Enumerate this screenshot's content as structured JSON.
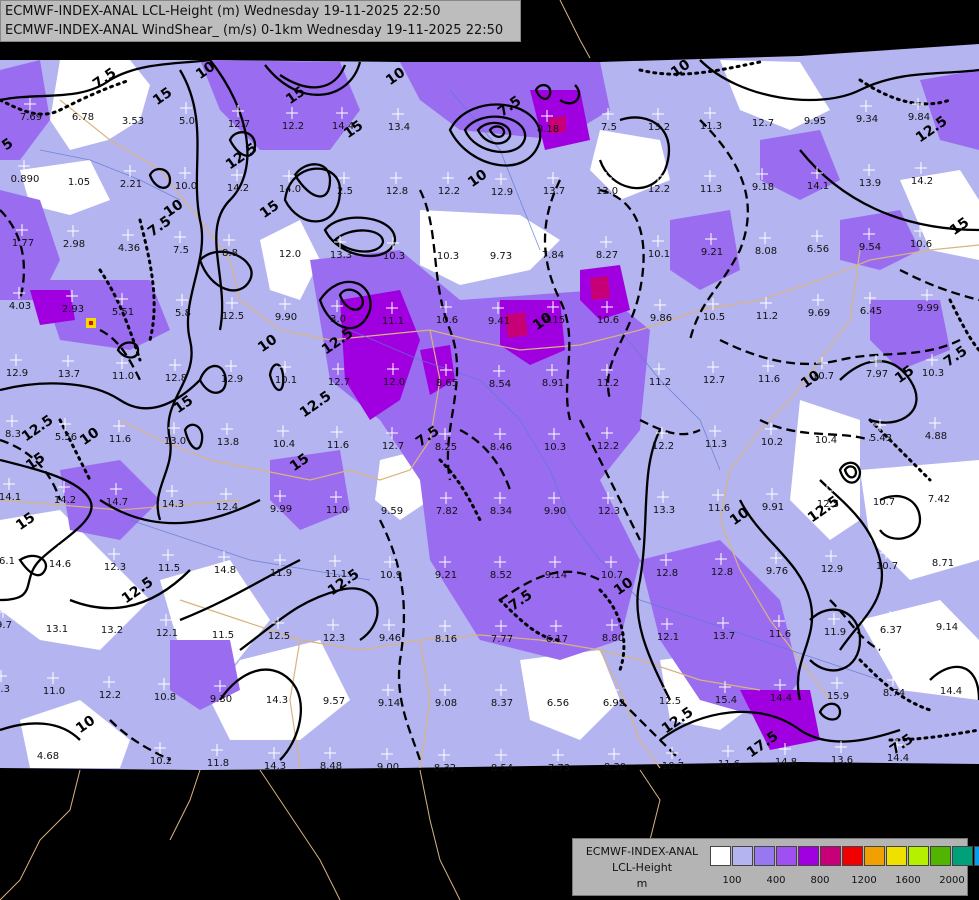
{
  "header": {
    "line1": "ECMWF-INDEX-ANAL LCL-Height (m) Wednesday 19-11-2025 22:50",
    "line2": "ECMWF-INDEX-ANAL WindShear_ (m/s) 0-1km Wednesday 19-11-2025 22:50"
  },
  "legend": {
    "title1": "ECMWF-INDEX-ANAL",
    "title2": "LCL-Height",
    "title3": "m",
    "colors": [
      "#ffffff",
      "#b4b4f0",
      "#9878f0",
      "#a050f0",
      "#a000e0",
      "#c80078",
      "#f00000",
      "#f0a000",
      "#f0e000",
      "#b4f000",
      "#50b400",
      "#00a078",
      "#00a0f0"
    ],
    "ticks": [
      "100",
      "400",
      "800",
      "1200",
      "1600",
      "2000"
    ]
  },
  "map": {
    "palette": {
      "white": "#ffffff",
      "lavender": "#b4b4f0",
      "light_purple": "#9a6cf0",
      "purple": "#a000e0",
      "magenta": "#c80078",
      "mask": "#000000"
    },
    "values": [
      [
        "7.69",
        30,
        116
      ],
      [
        "6.78",
        82,
        116
      ],
      [
        "3.53",
        132,
        120
      ],
      [
        "5.0",
        186,
        120
      ],
      [
        "12.7",
        238,
        123
      ],
      [
        "12.2",
        292,
        125
      ],
      [
        "14.4",
        342,
        125
      ],
      [
        "13.4",
        398,
        126
      ],
      [
        "8.18",
        547,
        128
      ],
      [
        "7.5",
        608,
        126
      ],
      [
        "13.2",
        658,
        126
      ],
      [
        "11.3",
        710,
        125
      ],
      [
        "12.7",
        762,
        122
      ],
      [
        "9.95",
        814,
        120
      ],
      [
        "9.34",
        866,
        118
      ],
      [
        "9.84",
        918,
        116
      ],
      [
        "0.890",
        24,
        178
      ],
      [
        "1.05",
        78,
        181
      ],
      [
        "2.21",
        130,
        183
      ],
      [
        "10.0",
        185,
        185
      ],
      [
        "14.2",
        237,
        187
      ],
      [
        "14.0",
        289,
        188
      ],
      [
        "2.5",
        344,
        190
      ],
      [
        "12.8",
        396,
        190
      ],
      [
        "12.2",
        448,
        190
      ],
      [
        "12.9",
        501,
        191
      ],
      [
        "13.7",
        553,
        190
      ],
      [
        "13.0",
        606,
        190
      ],
      [
        "12.2",
        658,
        188
      ],
      [
        "11.3",
        710,
        188
      ],
      [
        "9.18",
        762,
        186
      ],
      [
        "14.1",
        817,
        185
      ],
      [
        "13.9",
        869,
        182
      ],
      [
        "14.2",
        921,
        180
      ],
      [
        "1.77",
        22,
        242
      ],
      [
        "2.98",
        73,
        243
      ],
      [
        "4.36",
        128,
        247
      ],
      [
        "7.5",
        180,
        249
      ],
      [
        "8.8",
        229,
        252
      ],
      [
        "12.0",
        289,
        253
      ],
      [
        "13.3",
        340,
        254
      ],
      [
        "10.3",
        393,
        255
      ],
      [
        "10.3",
        447,
        255
      ],
      [
        "9.73",
        500,
        255
      ],
      [
        "7.84",
        552,
        254
      ],
      [
        "8.27",
        606,
        254
      ],
      [
        "10.1",
        658,
        253
      ],
      [
        "9.21",
        711,
        251
      ],
      [
        "8.08",
        765,
        250
      ],
      [
        "6.56",
        817,
        248
      ],
      [
        "9.54",
        869,
        246
      ],
      [
        "10.6",
        920,
        243
      ],
      [
        "4.03",
        19,
        305
      ],
      [
        "2.93",
        72,
        308
      ],
      [
        "5.51",
        122,
        311
      ],
      [
        "5.8",
        182,
        312
      ],
      [
        "12.5",
        232,
        315
      ],
      [
        "9.90",
        285,
        316
      ],
      [
        "3.0",
        337,
        318
      ],
      [
        "11.1",
        392,
        320
      ],
      [
        "10.6",
        446,
        319
      ],
      [
        "9.41",
        498,
        320
      ],
      [
        "9.15",
        553,
        319
      ],
      [
        "10.6",
        607,
        319
      ],
      [
        "9.86",
        660,
        317
      ],
      [
        "10.5",
        713,
        316
      ],
      [
        "11.2",
        766,
        315
      ],
      [
        "9.69",
        818,
        312
      ],
      [
        "6.45",
        870,
        310
      ],
      [
        "9.99",
        927,
        307
      ],
      [
        "12.9",
        16,
        372
      ],
      [
        "13.7",
        68,
        373
      ],
      [
        "11.0",
        122,
        375
      ],
      [
        "12.8",
        175,
        377
      ],
      [
        "12.9",
        231,
        378
      ],
      [
        "10.1",
        285,
        379
      ],
      [
        "12.7",
        338,
        381
      ],
      [
        "12.0",
        393,
        381
      ],
      [
        "8.65",
        446,
        382
      ],
      [
        "8.54",
        499,
        383
      ],
      [
        "8.91",
        552,
        382
      ],
      [
        "11.2",
        607,
        382
      ],
      [
        "11.2",
        659,
        381
      ],
      [
        "12.7",
        713,
        379
      ],
      [
        "11.6",
        768,
        378
      ],
      [
        "10.7",
        822,
        375
      ],
      [
        "7.97",
        876,
        373
      ],
      [
        "10.3",
        932,
        372
      ],
      [
        "8.3",
        12,
        433
      ],
      [
        "5.56",
        65,
        436
      ],
      [
        "11.6",
        119,
        438
      ],
      [
        "13.0",
        174,
        440
      ],
      [
        "13.8",
        227,
        441
      ],
      [
        "10.4",
        283,
        443
      ],
      [
        "11.6",
        337,
        444
      ],
      [
        "12.7",
        392,
        445
      ],
      [
        "8.25",
        445,
        446
      ],
      [
        "8.46",
        500,
        446
      ],
      [
        "10.3",
        554,
        446
      ],
      [
        "12.2",
        607,
        445
      ],
      [
        "12.2",
        662,
        445
      ],
      [
        "11.3",
        715,
        443
      ],
      [
        "10.2",
        771,
        441
      ],
      [
        "10.4",
        825,
        439
      ],
      [
        "5.43",
        880,
        437
      ],
      [
        "4.88",
        935,
        435
      ],
      [
        "14.1",
        9,
        496
      ],
      [
        "14.2",
        64,
        499
      ],
      [
        "14.7",
        116,
        501
      ],
      [
        "14.3",
        172,
        503
      ],
      [
        "12.4",
        226,
        506
      ],
      [
        "9.99",
        280,
        508
      ],
      [
        "11.0",
        336,
        509
      ],
      [
        "9.59",
        391,
        510
      ],
      [
        "7.82",
        446,
        510
      ],
      [
        "8.34",
        500,
        510
      ],
      [
        "9.90",
        554,
        510
      ],
      [
        "12.3",
        608,
        510
      ],
      [
        "13.3",
        663,
        509
      ],
      [
        "11.6",
        718,
        507
      ],
      [
        "9.91",
        772,
        506
      ],
      [
        "12.5",
        827,
        503
      ],
      [
        "10.7",
        883,
        501
      ],
      [
        "7.42",
        938,
        498
      ],
      [
        "6.1",
        6,
        560
      ],
      [
        "14.6",
        59,
        563
      ],
      [
        "12.3",
        114,
        566
      ],
      [
        "11.5",
        168,
        567
      ],
      [
        "14.8",
        224,
        569
      ],
      [
        "11.9",
        280,
        572
      ],
      [
        "11.1",
        335,
        573
      ],
      [
        "10.9",
        390,
        574
      ],
      [
        "9.21",
        445,
        574
      ],
      [
        "8.52",
        500,
        574
      ],
      [
        "9.14",
        555,
        574
      ],
      [
        "10.7",
        611,
        574
      ],
      [
        "12.8",
        666,
        572
      ],
      [
        "12.8",
        721,
        571
      ],
      [
        "9.76",
        776,
        570
      ],
      [
        "12.9",
        831,
        568
      ],
      [
        "10.7",
        886,
        565
      ],
      [
        "8.71",
        942,
        562
      ],
      [
        "9.7",
        3,
        624
      ],
      [
        "13.1",
        56,
        628
      ],
      [
        "13.2",
        111,
        629
      ],
      [
        "12.1",
        166,
        632
      ],
      [
        "11.5",
        222,
        634
      ],
      [
        "12.5",
        278,
        635
      ],
      [
        "12.3",
        333,
        637
      ],
      [
        "9.46",
        389,
        637
      ],
      [
        "8.16",
        445,
        638
      ],
      [
        "7.77",
        501,
        638
      ],
      [
        "6.17",
        556,
        638
      ],
      [
        "8.80",
        612,
        637
      ],
      [
        "12.1",
        667,
        636
      ],
      [
        "13.7",
        723,
        635
      ],
      [
        "11.6",
        779,
        633
      ],
      [
        "11.9",
        834,
        631
      ],
      [
        "6.37",
        890,
        629
      ],
      [
        "9.14",
        946,
        626
      ],
      [
        "8.3",
        1,
        688
      ],
      [
        "11.0",
        53,
        690
      ],
      [
        "12.2",
        109,
        694
      ],
      [
        "10.8",
        164,
        696
      ],
      [
        "9.30",
        220,
        698
      ],
      [
        "14.3",
        276,
        699
      ],
      [
        "9.57",
        333,
        700
      ],
      [
        "9.14",
        388,
        702
      ],
      [
        "9.08",
        445,
        702
      ],
      [
        "8.37",
        501,
        702
      ],
      [
        "6.56",
        557,
        702
      ],
      [
        "6.92",
        613,
        702
      ],
      [
        "12.5",
        669,
        700
      ],
      [
        "15.4",
        725,
        699
      ],
      [
        "14.4",
        780,
        697
      ],
      [
        "15.9",
        837,
        695
      ],
      [
        "8.74",
        893,
        692
      ],
      [
        "14.4",
        950,
        690
      ],
      [
        "4.68",
        47,
        755
      ],
      [
        "10.2",
        160,
        760
      ],
      [
        "11.8",
        217,
        762
      ],
      [
        "14.3",
        274,
        765
      ],
      [
        "8.48",
        330,
        765
      ],
      [
        "9.00",
        387,
        766
      ],
      [
        "8.32",
        444,
        767
      ],
      [
        "8.54",
        501,
        767
      ],
      [
        "7.73",
        558,
        767
      ],
      [
        "8.30",
        614,
        766
      ],
      [
        "10.7",
        672,
        765
      ],
      [
        "11.6",
        728,
        763
      ],
      [
        "14.8",
        785,
        761
      ],
      [
        "13.6",
        841,
        759
      ],
      [
        "14.4",
        897,
        757
      ]
    ],
    "contour_labels": [
      [
        "7.5",
        107,
        82
      ],
      [
        "10",
        208,
        74
      ],
      [
        "15",
        298,
        99
      ],
      [
        "10",
        398,
        80
      ],
      [
        "7.5",
        512,
        110
      ],
      [
        "10",
        683,
        72
      ],
      [
        "12.5",
        934,
        133
      ],
      [
        "15",
        962,
        230
      ],
      [
        "7.5",
        958,
        360
      ],
      [
        "15",
        356,
        133
      ],
      [
        "15",
        272,
        213
      ],
      [
        "12.5",
        244,
        160
      ],
      [
        "15",
        165,
        100
      ],
      [
        "10",
        480,
        182
      ],
      [
        "12.5",
        340,
        345
      ],
      [
        "12.5",
        318,
        408
      ],
      [
        "15",
        302,
        466
      ],
      [
        "7.5",
        430,
        440
      ],
      [
        "10",
        545,
        325
      ],
      [
        "10",
        813,
        383
      ],
      [
        "15",
        907,
        378
      ],
      [
        "10",
        742,
        520
      ],
      [
        "12.5",
        826,
        513
      ],
      [
        "15",
        38,
        465
      ],
      [
        "12.5",
        40,
        432
      ],
      [
        "10",
        92,
        440
      ],
      [
        "15",
        28,
        525
      ],
      [
        "12.5",
        140,
        594
      ],
      [
        "12.5",
        346,
        586
      ],
      [
        "7.5",
        523,
        604
      ],
      [
        "10",
        626,
        590
      ],
      [
        "12.5",
        680,
        724
      ],
      [
        "17.5",
        765,
        748
      ],
      [
        "7.5",
        904,
        748
      ],
      [
        "10",
        88,
        728
      ],
      [
        "15",
        186,
        408
      ],
      [
        "10",
        270,
        347
      ],
      [
        "10",
        176,
        212
      ],
      [
        "5",
        10,
        148
      ],
      [
        "7.5",
        162,
        230
      ]
    ]
  }
}
